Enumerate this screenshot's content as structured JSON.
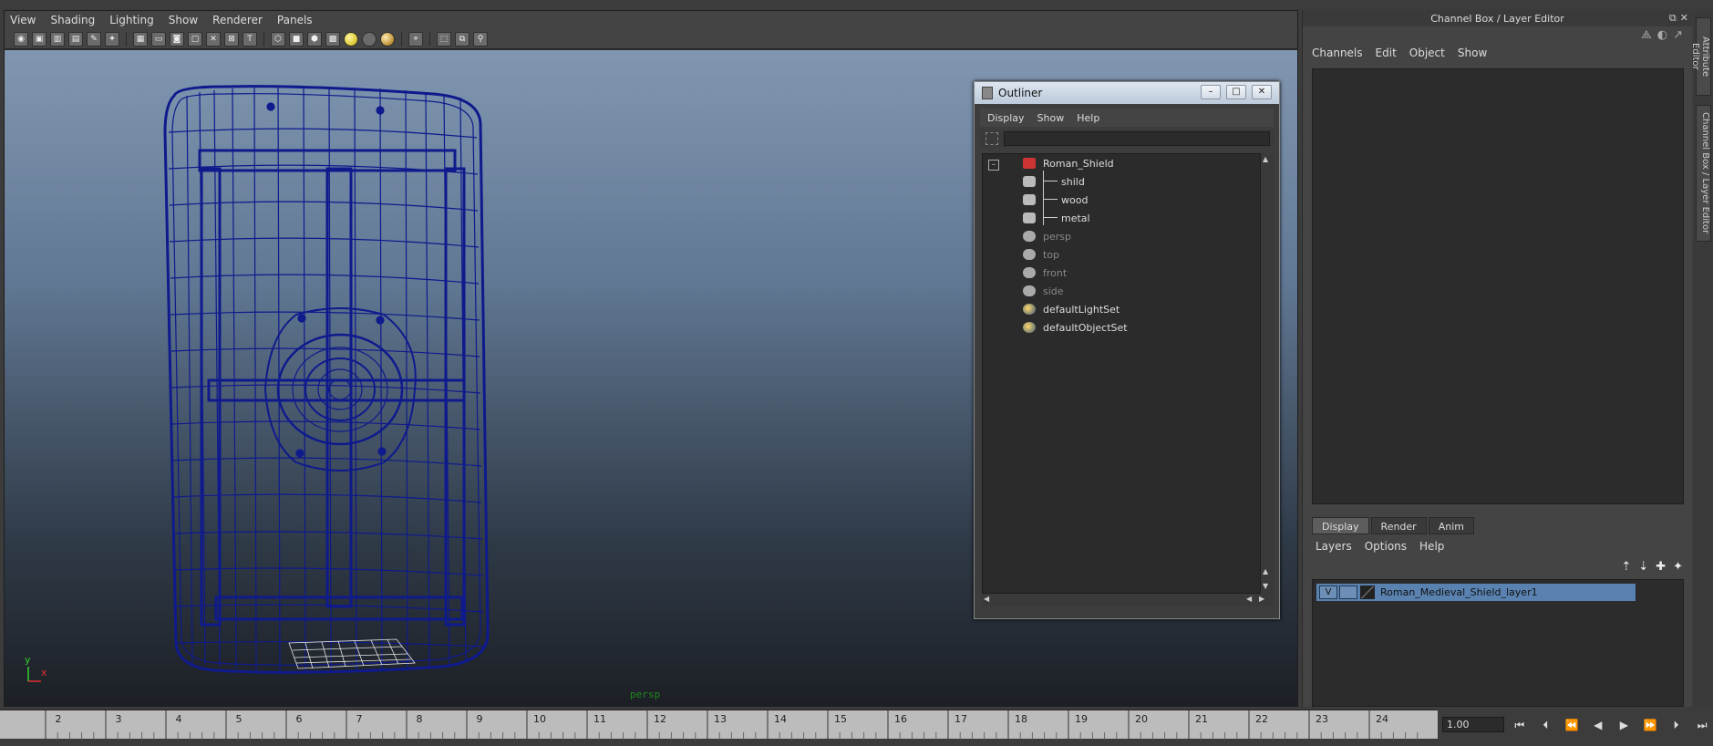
{
  "viewport_panel": {
    "menus": [
      "View",
      "Shading",
      "Lighting",
      "Show",
      "Renderer",
      "Panels"
    ],
    "camera_label": "persp",
    "axis_labels": {
      "y": "y",
      "x": "x"
    }
  },
  "outliner": {
    "title": "Outliner",
    "menus": [
      "Display",
      "Show",
      "Help"
    ],
    "items": [
      {
        "label": "Roman_Shield",
        "icon": "transform-icon",
        "indent": 0,
        "dim": false
      },
      {
        "label": "shild",
        "icon": "mesh-icon",
        "indent": 1,
        "dim": false
      },
      {
        "label": "wood",
        "icon": "mesh-icon",
        "indent": 1,
        "dim": false
      },
      {
        "label": "metal",
        "icon": "mesh-icon",
        "indent": 1,
        "dim": false
      },
      {
        "label": "persp",
        "icon": "camera-icon",
        "indent": 0,
        "dim": true
      },
      {
        "label": "top",
        "icon": "camera-icon",
        "indent": 0,
        "dim": true
      },
      {
        "label": "front",
        "icon": "camera-icon",
        "indent": 0,
        "dim": true
      },
      {
        "label": "side",
        "icon": "camera-icon",
        "indent": 0,
        "dim": true
      },
      {
        "label": "defaultLightSet",
        "icon": "set-icon",
        "indent": 0,
        "dim": false
      },
      {
        "label": "defaultObjectSet",
        "icon": "set-icon",
        "indent": 0,
        "dim": false
      }
    ]
  },
  "right_panel": {
    "title": "Channel Box / Layer Editor",
    "channel_menus": [
      "Channels",
      "Edit",
      "Object",
      "Show"
    ],
    "layer_tabs": [
      "Display",
      "Render",
      "Anim"
    ],
    "active_tab": "Display",
    "layer_menus": [
      "Layers",
      "Options",
      "Help"
    ],
    "layers": [
      {
        "visible_flag": "V",
        "name": "Roman_Medieval_Shield_layer1"
      }
    ]
  },
  "side_tabs": [
    "Attribute Editor",
    "Channel Box / Layer Editor"
  ],
  "timeline": {
    "ticks": [
      "2",
      "3",
      "4",
      "5",
      "6",
      "7",
      "8",
      "9",
      "10",
      "11",
      "12",
      "13",
      "14",
      "15",
      "16",
      "17",
      "18",
      "19",
      "20",
      "21",
      "22",
      "23",
      "24"
    ],
    "current_time": "1.00"
  },
  "colors": {
    "wireframe": "#0f1a8c",
    "layer_highlight": "#5a82b0",
    "camera_label": "#1f8a1f"
  }
}
